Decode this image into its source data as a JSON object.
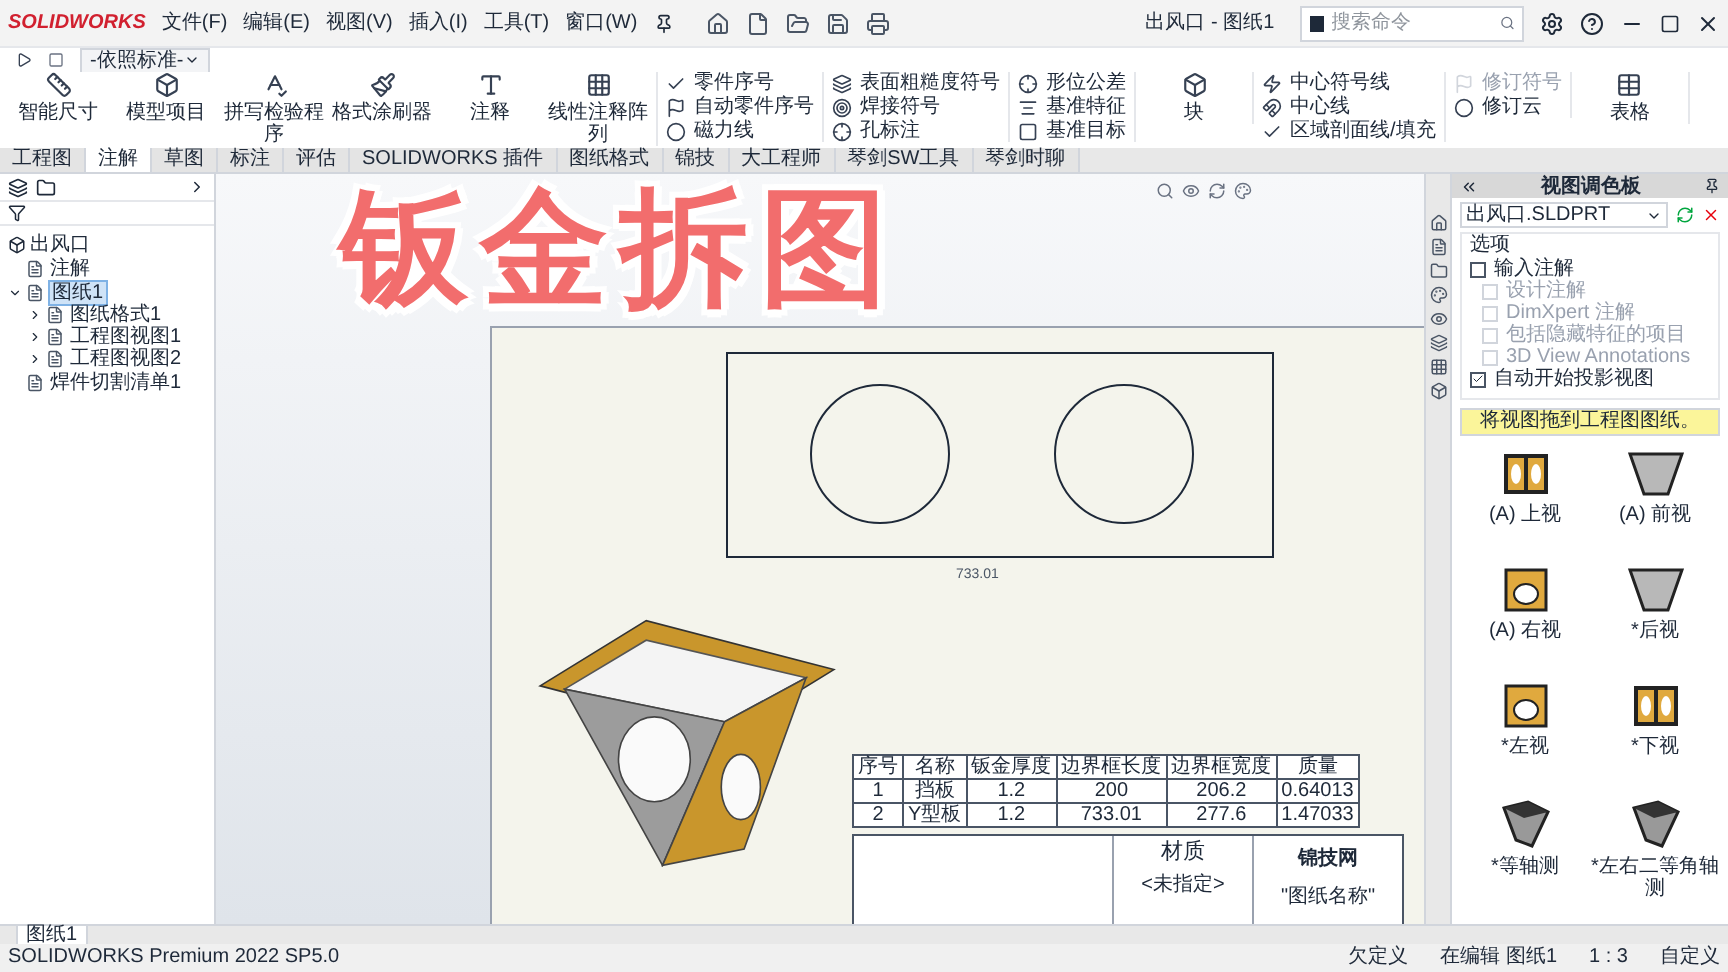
{
  "title_bar": {
    "logo": "SOLIDWORKS",
    "menus": [
      "文件(F)",
      "编辑(E)",
      "视图(V)",
      "插入(I)",
      "工具(T)",
      "窗口(W)"
    ],
    "document_title": "出风口 - 图纸1",
    "search": {
      "placeholder": "搜索命令"
    }
  },
  "standard_toolbar": {
    "dropdown": "-依照标准-"
  },
  "ribbon": {
    "groups": [
      {
        "kind": "large",
        "items": [
          {
            "label": "智能尺寸",
            "disabled": false
          },
          {
            "label": "模型项目",
            "disabled": false
          },
          {
            "label": "拼写检验程序",
            "disabled": false
          },
          {
            "label": "格式涂刷器",
            "disabled": false
          },
          {
            "label": "注释",
            "disabled": false
          },
          {
            "label": "线性注释阵列",
            "disabled": false
          }
        ]
      },
      {
        "kind": "stack",
        "items": [
          {
            "label": "零件序号",
            "disabled": false
          },
          {
            "label": "自动零件序号",
            "disabled": false
          },
          {
            "label": "磁力线",
            "disabled": false
          }
        ]
      },
      {
        "kind": "stack",
        "items": [
          {
            "label": "表面粗糙度符号",
            "disabled": false
          },
          {
            "label": "焊接符号",
            "disabled": false
          },
          {
            "label": "孔标注",
            "disabled": false
          }
        ]
      },
      {
        "kind": "stack",
        "items": [
          {
            "label": "形位公差",
            "disabled": false
          },
          {
            "label": "基准特征",
            "disabled": false
          },
          {
            "label": "基准目标",
            "disabled": false
          }
        ]
      },
      {
        "kind": "large",
        "items": [
          {
            "label": "块",
            "disabled": false
          }
        ]
      },
      {
        "kind": "stack",
        "items": [
          {
            "label": "中心符号线",
            "disabled": false
          },
          {
            "label": "中心线",
            "disabled": false
          },
          {
            "label": "区域剖面线/填充",
            "disabled": false
          }
        ]
      },
      {
        "kind": "stack",
        "items": [
          {
            "label": "修订符号",
            "disabled": true
          },
          {
            "label": "修订云",
            "disabled": false
          }
        ]
      },
      {
        "kind": "large",
        "items": [
          {
            "label": "表格",
            "disabled": false
          }
        ]
      }
    ]
  },
  "tabs": [
    {
      "label": "工程图",
      "selected": false
    },
    {
      "label": "注解",
      "selected": true
    },
    {
      "label": "草图",
      "selected": false
    },
    {
      "label": "标注",
      "selected": false
    },
    {
      "label": "评估",
      "selected": false
    },
    {
      "label": "SOLIDWORKS 插件",
      "selected": false
    },
    {
      "label": "图纸格式",
      "selected": false
    },
    {
      "label": "锦技",
      "selected": false
    },
    {
      "label": "大工程师",
      "selected": false
    },
    {
      "label": "琴剑SW工具",
      "selected": false
    },
    {
      "label": "琴剑时聊",
      "selected": false
    }
  ],
  "feature_tree": {
    "root": "出风口",
    "items": [
      {
        "label": "注解",
        "selected": false
      },
      {
        "label": "图纸1",
        "selected": true,
        "expanded": true,
        "children": [
          {
            "label": "图纸格式1",
            "selected": false,
            "expanded": false
          },
          {
            "label": "工程图视图1",
            "selected": false,
            "expanded": false
          },
          {
            "label": "工程图视图2",
            "selected": false,
            "expanded": false
          }
        ]
      },
      {
        "label": "焊件切割清单1",
        "selected": false
      }
    ]
  },
  "canvas": {
    "overlay_title": "钣金拆图",
    "drawing": {
      "dimension": "733.01",
      "bom": {
        "columns": [
          "序号",
          "名称",
          "钣金厚度",
          "边界框长度",
          "边界框宽度",
          "质量"
        ],
        "rows": [
          [
            "1",
            "挡板",
            "1.2",
            "200",
            "206.2",
            "0.64013"
          ],
          [
            "2",
            "Y型板",
            "1.2",
            "733.01",
            "277.6",
            "1.47033"
          ]
        ]
      },
      "title_block": {
        "material_label": "材质",
        "material_value": "<未指定>",
        "company": "锦技网",
        "drawing_name": "\"图纸名称\""
      }
    }
  },
  "task_pane": {
    "title": "视图调色板",
    "file": "出风口.SLDPRT",
    "options_label": "选项",
    "options": [
      {
        "label": "输入注解",
        "checked": false,
        "disabled": false
      },
      {
        "label": "设计注解",
        "checked": false,
        "disabled": true
      },
      {
        "label": "DimXpert 注解",
        "checked": false,
        "disabled": true
      },
      {
        "label": "包括隐藏特征的项目",
        "checked": false,
        "disabled": true
      },
      {
        "label": "3D View Annotations",
        "checked": false,
        "disabled": true
      },
      {
        "label": "自动开始投影视图",
        "checked": true,
        "disabled": false
      }
    ],
    "hint": "将视图拖到工程图图纸。",
    "views": [
      {
        "label": "(A) 上视",
        "kind": "frame"
      },
      {
        "label": "(A) 前视",
        "kind": "funnel"
      },
      {
        "label": "(A) 右视",
        "kind": "box"
      },
      {
        "label": "*后视",
        "kind": "funnel"
      },
      {
        "label": "*左视",
        "kind": "box"
      },
      {
        "label": "*下视",
        "kind": "frame"
      },
      {
        "label": "*等轴测",
        "kind": "iso"
      },
      {
        "label": "*左右二等角轴测",
        "kind": "iso"
      }
    ]
  },
  "sheet_tab": {
    "label": "图纸1"
  },
  "status_bar": {
    "product": "SOLIDWORKS Premium 2022 SP5.0",
    "state": "欠定义",
    "editing": "在编辑 图纸1",
    "scale": "1 : 3",
    "units": "自定义"
  }
}
